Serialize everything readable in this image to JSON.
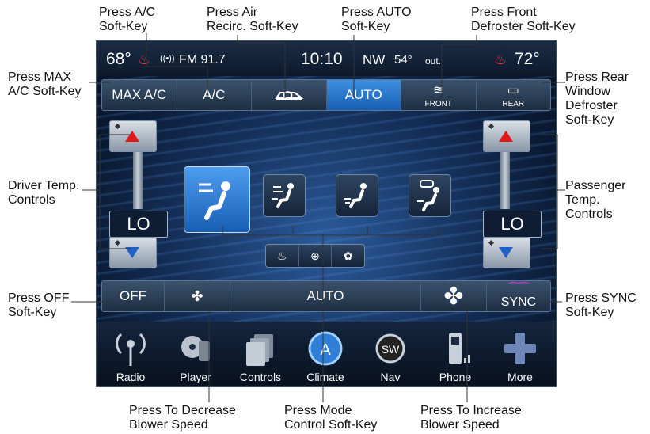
{
  "annotations": {
    "ac": "Press A/C\nSoft-Key",
    "recirc": "Press Air\nRecirc. Soft-Key",
    "auto": "Press AUTO\nSoft-Key",
    "front_defrost": "Press Front\nDefroster Soft-Key",
    "max_ac": "Press MAX\nA/C Soft-Key",
    "rear_defrost": "Press Rear\nWindow\nDefroster\nSoft-Key",
    "driver_temp": "Driver Temp.\nControls",
    "passenger_temp": "Passenger\nTemp.\nControls",
    "off": "Press OFF\nSoft-Key",
    "sync": "Press SYNC\nSoft-Key",
    "decrease_blower": "Press To Decrease\nBlower Speed",
    "mode_control": "Press Mode\nControl Soft-Key",
    "increase_blower": "Press To Increase\nBlower Speed"
  },
  "status": {
    "driver_temp": "68°",
    "radio": "FM 91.7",
    "clock": "10:10",
    "compass": "NW",
    "outside_temp": "54°",
    "outside_label": "out.",
    "passenger_temp": "72°"
  },
  "softkeys": {
    "max_ac": "MAX A/C",
    "ac": "A/C",
    "auto": "AUTO",
    "front": "FRONT",
    "rear": "REAR",
    "active": "AUTO"
  },
  "temp": {
    "driver_value": "LO",
    "passenger_value": "LO"
  },
  "blower": {
    "off": "OFF",
    "auto": "AUTO",
    "sync": "SYNC"
  },
  "nav": {
    "radio": "Radio",
    "player": "Player",
    "controls": "Controls",
    "climate": "Climate",
    "climate_icon": "A",
    "nav": "Nav",
    "nav_icon": "SW",
    "phone": "Phone",
    "more": "More",
    "active": "Climate"
  },
  "colors": {
    "active_blue": "#2f7fd8",
    "temp_up": "#e01818",
    "temp_down": "#1f5fc8"
  }
}
